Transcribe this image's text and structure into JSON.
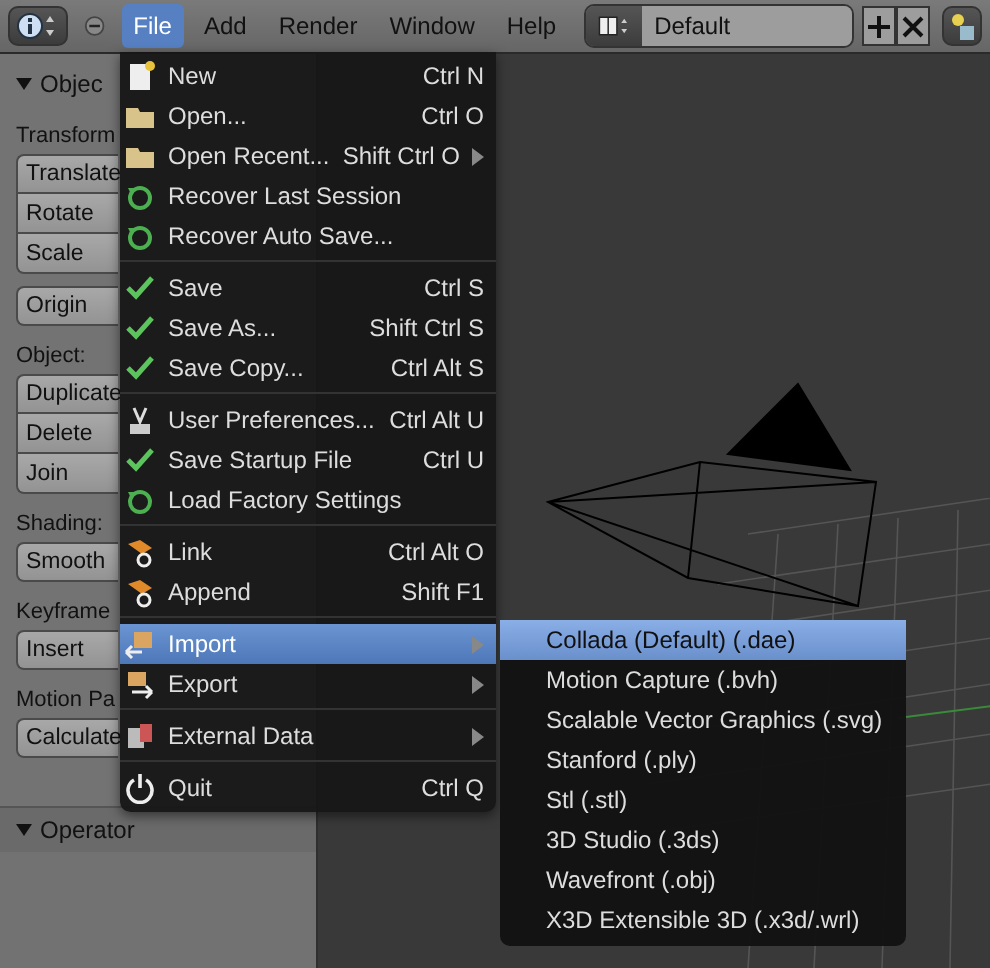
{
  "top_bar": {
    "menus": [
      {
        "label": "File",
        "selected": true
      },
      {
        "label": "Add",
        "selected": false
      },
      {
        "label": "Render",
        "selected": false
      },
      {
        "label": "Window",
        "selected": false
      },
      {
        "label": "Help",
        "selected": false
      }
    ],
    "layout": {
      "value": "Default"
    }
  },
  "tool_panel": {
    "header": {
      "title": "Objec",
      "expanded": true
    },
    "sections": [
      {
        "label": "Transform",
        "buttons": [
          "Translate",
          "Rotate",
          "Scale"
        ]
      },
      {
        "buttons": [
          "Origin"
        ]
      },
      {
        "label": "Object:",
        "buttons": [
          "Duplicate",
          "Delete",
          "Join"
        ]
      },
      {
        "label": "Shading:",
        "buttons": [
          "Smooth"
        ]
      },
      {
        "label": "Keyframe",
        "buttons": [
          "Insert"
        ]
      },
      {
        "label": "Motion Pa",
        "buttons": [
          "Calculate"
        ]
      }
    ],
    "operator": {
      "title": "Operator",
      "expanded": true
    }
  },
  "file_menu": {
    "groups": [
      [
        {
          "label": "New",
          "shortcut": "Ctrl N",
          "submenu": false,
          "selected": false
        },
        {
          "label": "Open...",
          "shortcut": "Ctrl O",
          "submenu": false,
          "selected": false
        },
        {
          "label": "Open Recent...",
          "shortcut": "Shift Ctrl O",
          "submenu": true,
          "selected": false
        },
        {
          "label": "Recover Last Session",
          "submenu": false,
          "selected": false
        },
        {
          "label": "Recover Auto Save...",
          "submenu": false,
          "selected": false
        }
      ],
      [
        {
          "label": "Save",
          "shortcut": "Ctrl S",
          "submenu": false,
          "selected": false
        },
        {
          "label": "Save As...",
          "shortcut": "Shift Ctrl S",
          "submenu": false,
          "selected": false
        },
        {
          "label": "Save Copy...",
          "shortcut": "Ctrl Alt S",
          "submenu": false,
          "selected": false
        }
      ],
      [
        {
          "label": "User Preferences...",
          "shortcut": "Ctrl Alt U",
          "submenu": false,
          "selected": false
        },
        {
          "label": "Save Startup File",
          "shortcut": "Ctrl U",
          "submenu": false,
          "selected": false
        },
        {
          "label": "Load Factory Settings",
          "submenu": false,
          "selected": false
        }
      ],
      [
        {
          "label": "Link",
          "shortcut": "Ctrl Alt O",
          "submenu": false,
          "selected": false
        },
        {
          "label": "Append",
          "shortcut": "Shift F1",
          "submenu": false,
          "selected": false
        }
      ],
      [
        {
          "label": "Import",
          "submenu": true,
          "selected": true
        },
        {
          "label": "Export",
          "submenu": true,
          "selected": false
        }
      ],
      [
        {
          "label": "External Data",
          "submenu": true,
          "selected": false
        }
      ],
      [
        {
          "label": "Quit",
          "shortcut": "Ctrl Q",
          "submenu": false,
          "selected": false
        }
      ]
    ]
  },
  "import_submenu": {
    "items": [
      {
        "label": "Collada (Default) (.dae)",
        "selected": true
      },
      {
        "label": "Motion Capture (.bvh)",
        "selected": false
      },
      {
        "label": "Scalable Vector Graphics (.svg)",
        "selected": false
      },
      {
        "label": "Stanford (.ply)",
        "selected": false
      },
      {
        "label": "Stl (.stl)",
        "selected": false
      },
      {
        "label": "3D Studio (.3ds)",
        "selected": false
      },
      {
        "label": "Wavefront (.obj)",
        "selected": false
      },
      {
        "label": "X3D Extensible 3D (.x3d/.wrl)",
        "selected": false
      }
    ]
  }
}
